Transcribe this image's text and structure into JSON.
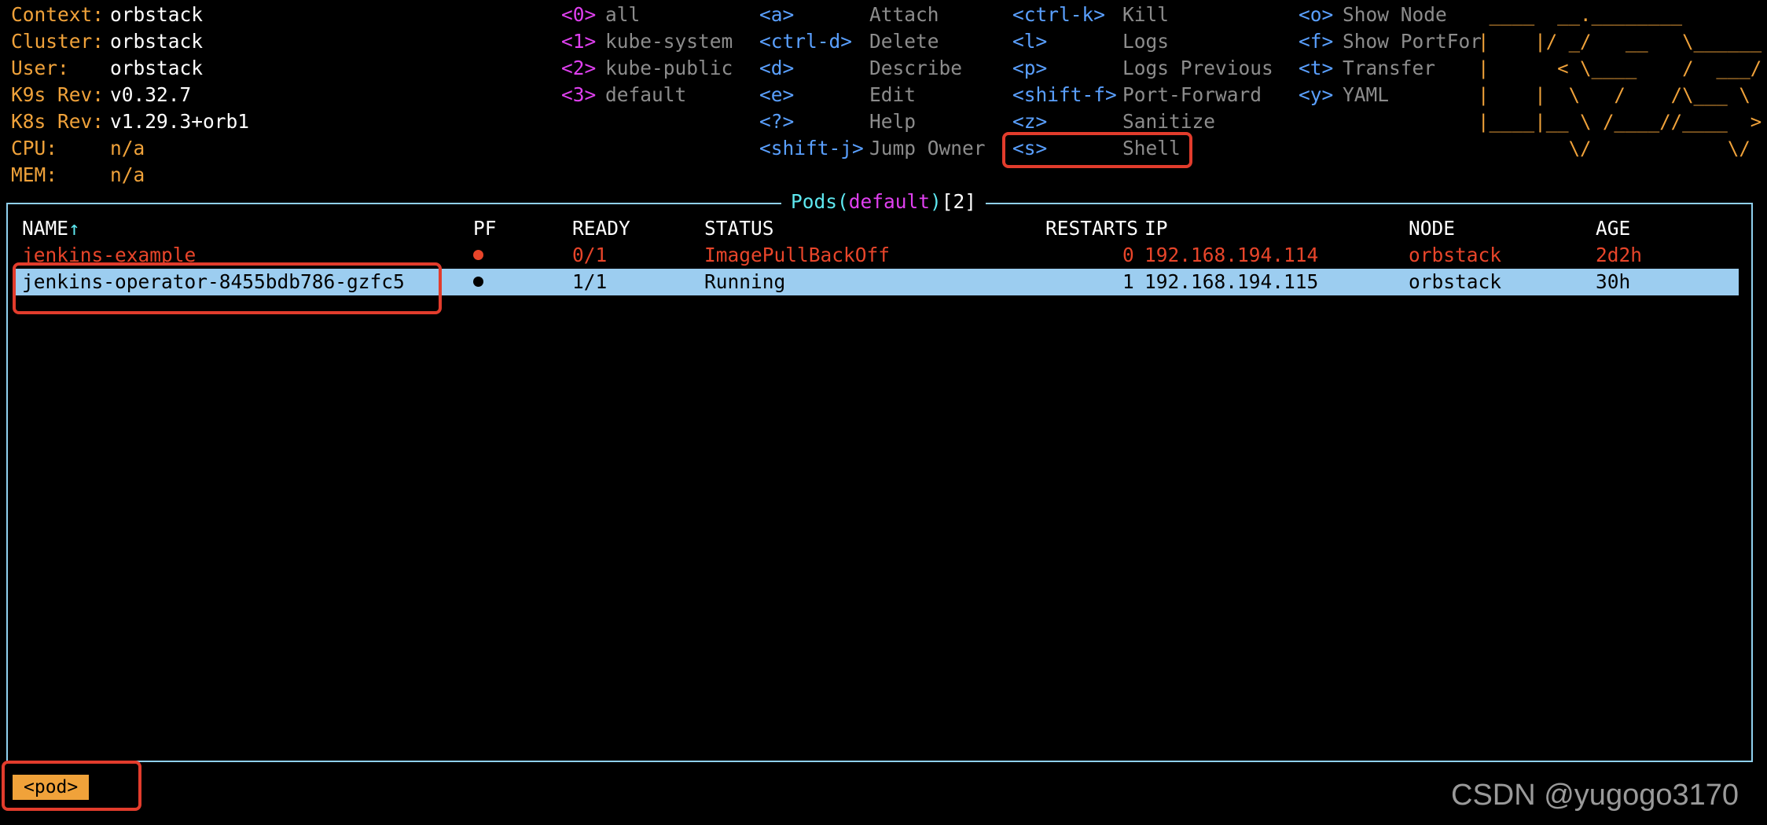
{
  "cluster_info": [
    {
      "key": "Context:",
      "value": "orbstack"
    },
    {
      "key": "Cluster:",
      "value": "orbstack"
    },
    {
      "key": "User:",
      "value": "orbstack"
    },
    {
      "key": "K9s Rev:",
      "value": "v0.32.7"
    },
    {
      "key": "K8s Rev:",
      "value": "v1.29.3+orb1"
    },
    {
      "key": "CPU:",
      "value": "n/a"
    },
    {
      "key": "MEM:",
      "value": "n/a"
    }
  ],
  "namespaces": [
    {
      "key": "<0>",
      "label": "all"
    },
    {
      "key": "<1>",
      "label": "kube-system"
    },
    {
      "key": "<2>",
      "label": "kube-public"
    },
    {
      "key": "<3>",
      "label": "default"
    }
  ],
  "shortcuts_col1": [
    {
      "key": "<a>",
      "label": "Attach"
    },
    {
      "key": "<ctrl-d>",
      "label": "Delete"
    },
    {
      "key": "<d>",
      "label": "Describe"
    },
    {
      "key": "<e>",
      "label": "Edit"
    },
    {
      "key": "<?>",
      "label": "Help"
    },
    {
      "key": "<shift-j>",
      "label": "Jump Owner"
    }
  ],
  "shortcuts_col2": [
    {
      "key": "<ctrl-k>",
      "label": "Kill"
    },
    {
      "key": "<l>",
      "label": "Logs"
    },
    {
      "key": "<p>",
      "label": "Logs Previous"
    },
    {
      "key": "<shift-f>",
      "label": "Port-Forward"
    },
    {
      "key": "<z>",
      "label": "Sanitize"
    },
    {
      "key": "<s>",
      "label": "Shell"
    }
  ],
  "shortcuts_col3": [
    {
      "key": "<o>",
      "label": "Show Node"
    },
    {
      "key": "<f>",
      "label": "Show PortFor"
    },
    {
      "key": "<t>",
      "label": "Transfer"
    },
    {
      "key": "<y>",
      "label": "YAML"
    }
  ],
  "logo_lines": [
    " ____  __.________",
    "|    |/ _/   __   \\______",
    "|      < \\____    /  ___/",
    "|    |  \\   /    /\\___ \\",
    "|____|__ \\ /____//____  >",
    "        \\/            \\/"
  ],
  "frame_title": {
    "resource": "Pods",
    "open_paren": "(",
    "namespace": "default",
    "close_paren": ")",
    "count": "[2]"
  },
  "table": {
    "headers": {
      "name": "NAME",
      "sort_arrow": "↑",
      "pf": "PF",
      "ready": "READY",
      "status": "STATUS",
      "restarts": "RESTARTS",
      "ip": "IP",
      "node": "NODE",
      "age": "AGE"
    },
    "rows": [
      {
        "name": "jenkins-example",
        "ready": "0/1",
        "status": "ImagePullBackOff",
        "restarts": "0",
        "ip": "192.168.194.114",
        "node": "orbstack",
        "age": "2d2h"
      },
      {
        "name": "jenkins-operator-8455bdb786-gzfc5",
        "ready": "1/1",
        "status": "Running",
        "restarts": "1",
        "ip": "192.168.194.115",
        "node": "orbstack",
        "age": "30h"
      }
    ]
  },
  "crumb": "<pod>",
  "watermark": "CSDN @yugogo3170",
  "colors": {
    "info_key": "#f0a23a",
    "namespace_key": "#e040f0",
    "shortcut_key": "#5aa0ff",
    "frame_border": "#8fd0ee",
    "error_row": "#e8452a",
    "selected_row_bg": "#9ccdf0",
    "highlight_box": "#e23c2c"
  }
}
